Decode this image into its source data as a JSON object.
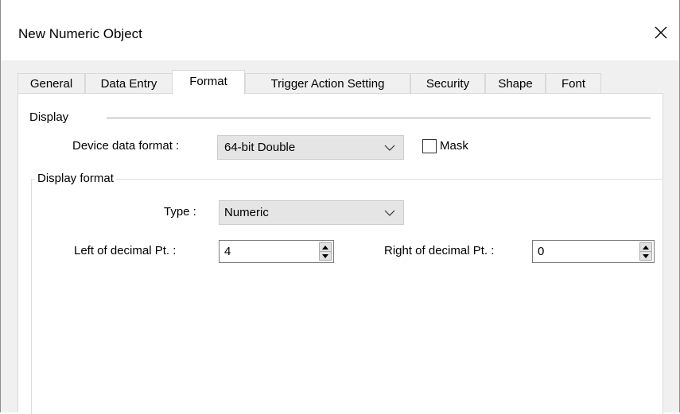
{
  "window": {
    "title": "New Numeric Object"
  },
  "tabs": [
    {
      "label": "General",
      "active": false
    },
    {
      "label": "Data Entry",
      "active": false
    },
    {
      "label": "Format",
      "active": true
    },
    {
      "label": "Trigger Action Setting",
      "active": false
    },
    {
      "label": "Security",
      "active": false
    },
    {
      "label": "Shape",
      "active": false
    },
    {
      "label": "Font",
      "active": false
    }
  ],
  "display": {
    "section_label": "Display",
    "device_data_format_label": "Device data format :",
    "device_data_format_value": "64-bit Double",
    "mask_label": "Mask",
    "mask_checked": false
  },
  "display_format": {
    "group_label": "Display format",
    "type_label": "Type :",
    "type_value": "Numeric",
    "left_decimal_label": "Left of decimal Pt. :",
    "left_decimal_value": "4",
    "right_decimal_label": "Right of decimal Pt. :",
    "right_decimal_value": "0"
  },
  "icons": {
    "close": "close-icon",
    "dropdown": "chevron-down-icon",
    "spin_up": "arrow-up-icon",
    "spin_down": "arrow-down-icon"
  },
  "colors": {
    "dialog_body": "#f0f0f0",
    "tab_page": "#ffffff",
    "combo_background": "#e5e5e5"
  }
}
